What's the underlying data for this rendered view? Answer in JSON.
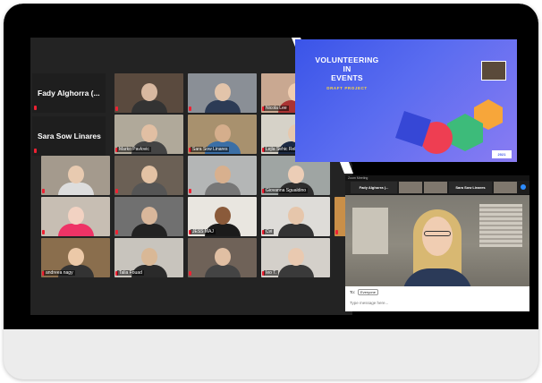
{
  "gallery": {
    "name_tiles": [
      {
        "label": "Fady Alghorra (..."
      },
      {
        "label": "Sara Sow Linares"
      }
    ],
    "participants": [
      {
        "name": "",
        "bg": "#5a4a3e",
        "skin": "#d8b8a0",
        "shirt": "#333"
      },
      {
        "name": "",
        "bg": "#8a8f96",
        "skin": "#e2c4aa",
        "shirt": "#2c3b55"
      },
      {
        "name": "Nicola Lee",
        "bg": "#c9a891",
        "skin": "#f0cdb0",
        "shirt": "#a33"
      },
      {
        "name": "Marko Pavlovic",
        "bg": "#b0a99a",
        "skin": "#e1bfa3",
        "shirt": "#444"
      },
      {
        "name": "Sara Sow Linares",
        "bg": "#a8916e",
        "skin": "#d5ae8c",
        "shirt": "#3b6fa6"
      },
      {
        "name": "Lejla Sehic Relic",
        "bg": "#d6d2c8",
        "skin": "#e7c8ad",
        "shirt": "#1c2a44"
      },
      {
        "name": "",
        "bg": "#a49a8d",
        "skin": "#e8cab0",
        "shirt": "#ddd"
      },
      {
        "name": "",
        "bg": "#6b6055",
        "skin": "#e3c2a4",
        "shirt": "#555"
      },
      {
        "name": "",
        "bg": "#b4b6b6",
        "skin": "#d8b08e",
        "shirt": "#777"
      },
      {
        "name": "Giovanna Sgualdino",
        "bg": "#9fa5a3",
        "skin": "#eccdb6",
        "shirt": "#2d2d2d"
      },
      {
        "name": "",
        "bg": "#c7beb3",
        "skin": "#f2d2c2",
        "shirt": "#e36"
      },
      {
        "name": "",
        "bg": "#707070",
        "skin": "#d9b79b",
        "shirt": "#222"
      },
      {
        "name": "JESS MAJ",
        "bg": "#e9e6e0",
        "skin": "#8a5a3a",
        "shirt": "#1b1b1b"
      },
      {
        "name": "Cvi",
        "bg": "#dedcd8",
        "skin": "#e6c6ab",
        "shirt": "#333"
      },
      {
        "name": "",
        "bg": "#c98f48",
        "skin": "#e5c5a8",
        "shirt": "#5a3a2a"
      },
      {
        "name": "andreea nagy",
        "bg": "#8a6e4d",
        "skin": "#ecc9a8",
        "shirt": "#333"
      },
      {
        "name": "Talia Fouad",
        "bg": "#c8c4bd",
        "skin": "#d9b896",
        "shirt": "#2a2a2a"
      },
      {
        "name": "",
        "bg": "#6f6258",
        "skin": "#e0bfa3",
        "shirt": "#444"
      },
      {
        "name": "Ieo T.",
        "bg": "#d4d0ca",
        "skin": "#e9c9b0",
        "shirt": "#3a3a3a"
      }
    ]
  },
  "slide": {
    "title": "VOLUNTEERING\nIN\nEVENTS",
    "subtitle": "DRAFT PROJECT",
    "logo": "2021",
    "colors": {
      "bg": "#4b5ff0",
      "orange": "#f7a63a",
      "red": "#ee3e52",
      "green": "#3dbb7a",
      "navy": "#3647d6"
    }
  },
  "zoom_window": {
    "title": "Zoom Meeting",
    "strip": [
      {
        "label": "Fady Alghorra (...",
        "kind": "name"
      },
      {
        "label": "",
        "kind": "video"
      },
      {
        "label": "",
        "kind": "video"
      },
      {
        "label": "Sara Sow Linares",
        "kind": "name"
      },
      {
        "label": "",
        "kind": "video"
      }
    ],
    "chat": {
      "to_label": "To:",
      "to_value": "Everyone",
      "placeholder": "Type message here..."
    }
  }
}
